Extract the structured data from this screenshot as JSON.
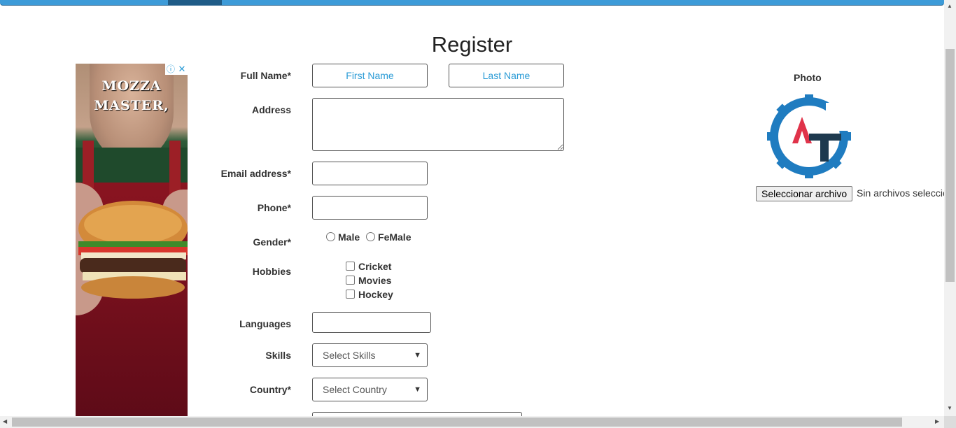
{
  "title": "Register",
  "ad": {
    "headline_line1": "MOZZA",
    "headline_line2": "MASTER,",
    "adchoice_icon": "info-icon",
    "close_icon": "close-icon"
  },
  "form": {
    "full_name_label": "Full Name*",
    "first_name_placeholder": "First Name",
    "last_name_placeholder": "Last Name",
    "address_label": "Address",
    "email_label": "Email address*",
    "phone_label": "Phone*",
    "gender_label": "Gender*",
    "gender_options": [
      "Male",
      "FeMale"
    ],
    "hobbies_label": "Hobbies",
    "hobbies": [
      "Cricket",
      "Movies",
      "Hockey"
    ],
    "languages_label": "Languages",
    "skills_label": "Skills",
    "skills_selected": "Select Skills",
    "country_label": "Country*",
    "country_selected": "Select Country"
  },
  "photo": {
    "label": "Photo",
    "file_button": "Seleccionar archivo",
    "file_status": "Sin archivos seleccionados"
  },
  "colors": {
    "nav": "#3d9bd8",
    "nav_active": "#1f5c87",
    "placeholder": "#2a9bd6",
    "logo_blue": "#1f7cc0",
    "logo_red": "#e0334a",
    "logo_dark": "#1e3a4f"
  }
}
